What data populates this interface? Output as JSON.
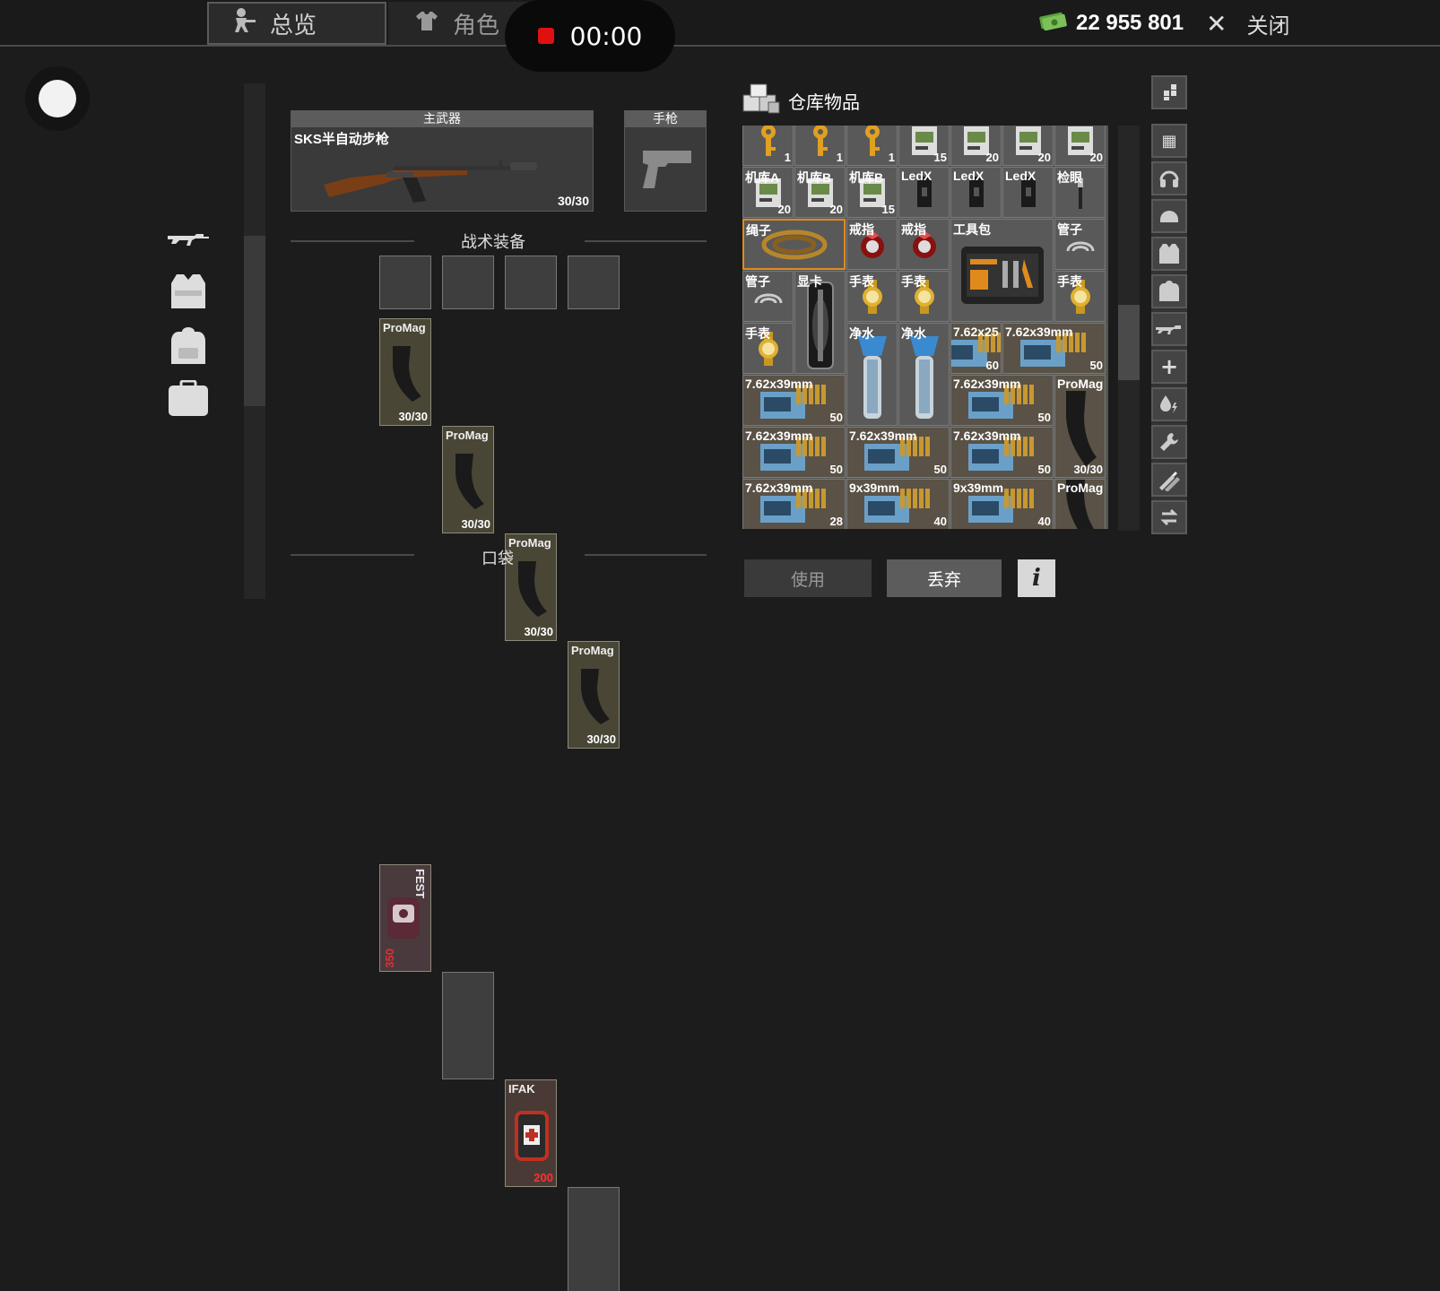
{
  "topbar": {
    "tab_overview": "总览",
    "tab_character": "角色",
    "timer": "00:00",
    "money": "22 955 801",
    "close_label": "关闭"
  },
  "loadout": {
    "primary_header": "主武器",
    "primary_name": "SKS半自动步枪",
    "primary_ammo": "30/30",
    "pistol_header": "手枪",
    "tactical_title": "战术装备",
    "pockets_title": "口袋",
    "mags": [
      {
        "label": "ProMag",
        "count": "30/30"
      },
      {
        "label": "ProMag",
        "count": "30/30"
      },
      {
        "label": "ProMag",
        "count": "30/30"
      },
      {
        "label": "ProMag",
        "count": "30/30"
      }
    ],
    "pocket_items": [
      {
        "label": "FEST",
        "count": "350"
      },
      {
        "label": "",
        "count": ""
      },
      {
        "label": "IFAK",
        "count": "200"
      },
      {
        "label": "",
        "count": ""
      }
    ]
  },
  "storage": {
    "title": "仓库物品",
    "cells": [
      {
        "name": "",
        "qty": "1",
        "icon": "key-icon"
      },
      {
        "name": "",
        "qty": "1",
        "icon": "key-icon"
      },
      {
        "name": "",
        "qty": "1",
        "icon": "key-icon"
      },
      {
        "name": "",
        "qty": "15",
        "icon": "keycard-icon"
      },
      {
        "name": "",
        "qty": "20",
        "icon": "keycard-icon"
      },
      {
        "name": "",
        "qty": "20",
        "icon": "keycard-icon"
      },
      {
        "name": "",
        "qty": "20",
        "icon": "keycard-icon"
      },
      {
        "name": "机库A",
        "qty": "20",
        "icon": "keycard-icon"
      },
      {
        "name": "机库B",
        "qty": "20",
        "icon": "keycard-icon"
      },
      {
        "name": "机库B",
        "qty": "15",
        "icon": "keycard-icon"
      },
      {
        "name": "LedX",
        "qty": "",
        "icon": "ledx-icon"
      },
      {
        "name": "LedX",
        "qty": "",
        "icon": "ledx-icon"
      },
      {
        "name": "LedX",
        "qty": "",
        "icon": "ledx-icon"
      },
      {
        "name": "检眼",
        "qty": "",
        "icon": "ophthalmoscope-icon"
      },
      {
        "name": "绳子",
        "qty": "",
        "icon": "rope-icon"
      },
      {
        "name": "戒指",
        "qty": "",
        "icon": "ring-icon"
      },
      {
        "name": "戒指",
        "qty": "",
        "icon": "ring-icon"
      },
      {
        "name": "工具包",
        "qty": "",
        "icon": "toolkit-icon"
      },
      {
        "name": "管子",
        "qty": "",
        "icon": "tube-icon"
      },
      {
        "name": "管子",
        "qty": "",
        "icon": "tube-icon"
      },
      {
        "name": "显卡",
        "qty": "",
        "icon": "gpu-icon"
      },
      {
        "name": "手表",
        "qty": "",
        "icon": "watch-icon"
      },
      {
        "name": "手表",
        "qty": "",
        "icon": "watch-icon"
      },
      {
        "name": "手表",
        "qty": "",
        "icon": "watch-icon"
      },
      {
        "name": "手表",
        "qty": "",
        "icon": "watch-icon"
      },
      {
        "name": "净水",
        "qty": "",
        "icon": "water-filter-icon"
      },
      {
        "name": "净水",
        "qty": "",
        "icon": "water-filter-icon"
      },
      {
        "name": "7.62x25",
        "qty": "60",
        "icon": "ammo-box-icon"
      },
      {
        "name": "7.62x39mm",
        "qty": "50",
        "icon": "ammo-box-icon"
      },
      {
        "name": "7.62x39mm",
        "qty": "50",
        "icon": "ammo-box-icon"
      },
      {
        "name": "7.62x39mm",
        "qty": "50",
        "icon": "ammo-box-icon"
      },
      {
        "name": "ProMag",
        "qty": "30/30",
        "icon": "magazine-icon"
      },
      {
        "name": "7.62x39mm",
        "qty": "50",
        "icon": "ammo-box-icon"
      },
      {
        "name": "7.62x39mm",
        "qty": "50",
        "icon": "ammo-box-icon"
      },
      {
        "name": "7.62x39mm",
        "qty": "50",
        "icon": "ammo-box-icon"
      },
      {
        "name": "7.62x39mm",
        "qty": "28",
        "icon": "ammo-box-icon"
      },
      {
        "name": "9x39mm",
        "qty": "40",
        "icon": "ammo-box-icon"
      },
      {
        "name": "9x39mm",
        "qty": "40",
        "icon": "ammo-box-icon"
      },
      {
        "name": "ProMag",
        "qty": "",
        "icon": "magazine-icon"
      }
    ]
  },
  "filters": [
    "grid-small-icon",
    "grid-all-icon",
    "headset-icon",
    "helmet-icon",
    "vest-icon",
    "backpack-icon",
    "rifle-icon",
    "medical-icon",
    "consumable-icon",
    "tool-icon",
    "ammo-icon",
    "swap-icon"
  ],
  "actions": {
    "use": "使用",
    "discard": "丢弃",
    "info": "i"
  },
  "colors": {
    "accent_selected": "#e08a1e",
    "record_red": "#e01010",
    "money_green": "#5aa040"
  }
}
